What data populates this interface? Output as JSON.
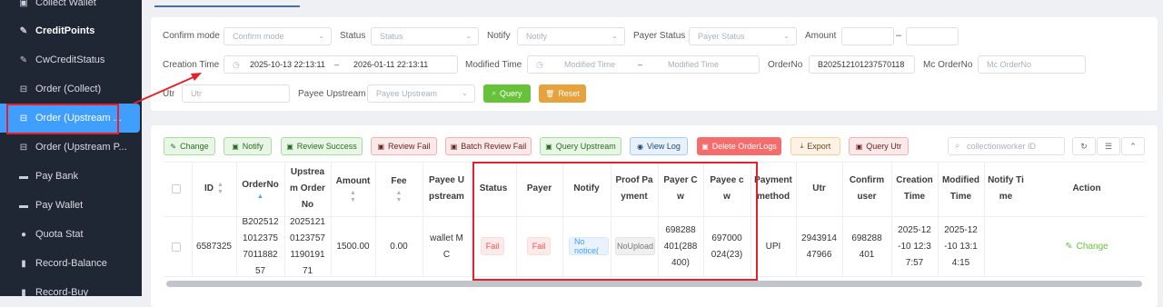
{
  "sidebar": {
    "items": [
      {
        "label": "Collect Wallet",
        "icon": "wallet-icon"
      },
      {
        "label": "CreditPoints",
        "icon": "edit-icon"
      },
      {
        "label": "CwCreditStatus",
        "icon": "edit-icon"
      },
      {
        "label": "Order (Collect)",
        "icon": "bag-icon"
      },
      {
        "label": "Order (Upstream ...",
        "icon": "bag-icon"
      },
      {
        "label": "Order (Upstream P...",
        "icon": "bag-icon"
      },
      {
        "label": "Pay Bank",
        "icon": "card-icon"
      },
      {
        "label": "Pay Wallet",
        "icon": "card-icon"
      },
      {
        "label": "Quota Stat",
        "icon": "circle-icon"
      },
      {
        "label": "Record-Balance",
        "icon": "bookmark-icon"
      },
      {
        "label": "Record-Buy",
        "icon": "bookmark-icon"
      }
    ]
  },
  "filters": {
    "confirm_mode": {
      "label": "Confirm mode",
      "placeholder": "Confirm mode"
    },
    "status": {
      "label": "Status",
      "placeholder": "Status"
    },
    "notify": {
      "label": "Notify",
      "placeholder": "Notify"
    },
    "payer_status": {
      "label": "Payer Status",
      "placeholder": "Payer Status"
    },
    "amount": {
      "label": "Amount",
      "dash": "–"
    },
    "creation_time": {
      "label": "Creation Time",
      "start": "2025-10-13 22:13:11",
      "end": "2026-01-11 22:13:11",
      "sep": "–"
    },
    "modified_time": {
      "label": "Modified Time",
      "start_placeholder": "Modified Time",
      "end_placeholder": "Modified Time",
      "sep": "–"
    },
    "order_no": {
      "label": "OrderNo",
      "value": "B202512101237570118"
    },
    "mc_order_no": {
      "label": "Mc OrderNo",
      "placeholder": "Mc OrderNo"
    },
    "utr": {
      "label": "Utr",
      "placeholder": "Utr"
    },
    "payee_upstream": {
      "label": "Payee Upstream",
      "placeholder": "Payee Upstream"
    },
    "query_label": "Query",
    "reset_label": "Reset"
  },
  "toolbar": {
    "change": "Change",
    "notify": "Notify",
    "review_success": "Review Success",
    "review_fail": "Review Fail",
    "batch_review_fail": "Batch Review Fail",
    "query_upstream": "Query Upstream",
    "view_log": "View Log",
    "delete_orderlogs": "Delete OrderLogs",
    "export": "Export",
    "query_utr": "Query Utr",
    "search_placeholder": "collectionworker ID"
  },
  "table": {
    "headers": {
      "id": "ID",
      "order_no": "OrderNo",
      "upstream_order_no": [
        "Upstrea",
        "m Order",
        "No"
      ],
      "amount": "Amount",
      "fee": "Fee",
      "payee_upstream": [
        "Payee U",
        "pstream"
      ],
      "status": "Status",
      "payer": "Payer",
      "notify": "Notify",
      "proof_payment": [
        "Proof Pa",
        "yment"
      ],
      "payer_cw": [
        "Payer C",
        "w"
      ],
      "payee_cw": [
        "Payee c",
        "w"
      ],
      "payment_method": [
        "Payment",
        "method"
      ],
      "utr": "Utr",
      "confirm_user": [
        "Confirm",
        "user"
      ],
      "creation_time": [
        "Creation",
        "Time"
      ],
      "modified_time": [
        "Modified",
        "Time"
      ],
      "notify_time": [
        "Notify Ti",
        "me"
      ],
      "action": "Action"
    },
    "row": {
      "id": "6587325",
      "order_no": [
        "B202512",
        "1012375",
        "7011882",
        "57"
      ],
      "upstream_order_no": [
        "2025121",
        "0123757",
        "1190191",
        "71"
      ],
      "amount": "1500.00",
      "fee": "0.00",
      "payee_upstream": [
        "wallet M",
        "C"
      ],
      "status": "Fail",
      "payer": "Fail",
      "notify": "No notice(",
      "proof_payment": "NoUpload",
      "payer_cw": [
        "698288",
        "401(288",
        "400)"
      ],
      "payee_cw": [
        "697000",
        "024(23)"
      ],
      "payment_method": "UPI",
      "utr": [
        "2943914",
        "47966"
      ],
      "confirm_user": [
        "698288",
        "401"
      ],
      "creation_time": [
        "2025-12",
        "-10 12:3",
        "7:57"
      ],
      "modified_time": [
        "2025-12",
        "-10 13:1",
        "4:15"
      ],
      "notify_time": "",
      "action": "Change"
    }
  },
  "colors": {
    "sidebar_bg": "#1f2634",
    "active": "#409eff",
    "annotation": "#e5202a"
  }
}
